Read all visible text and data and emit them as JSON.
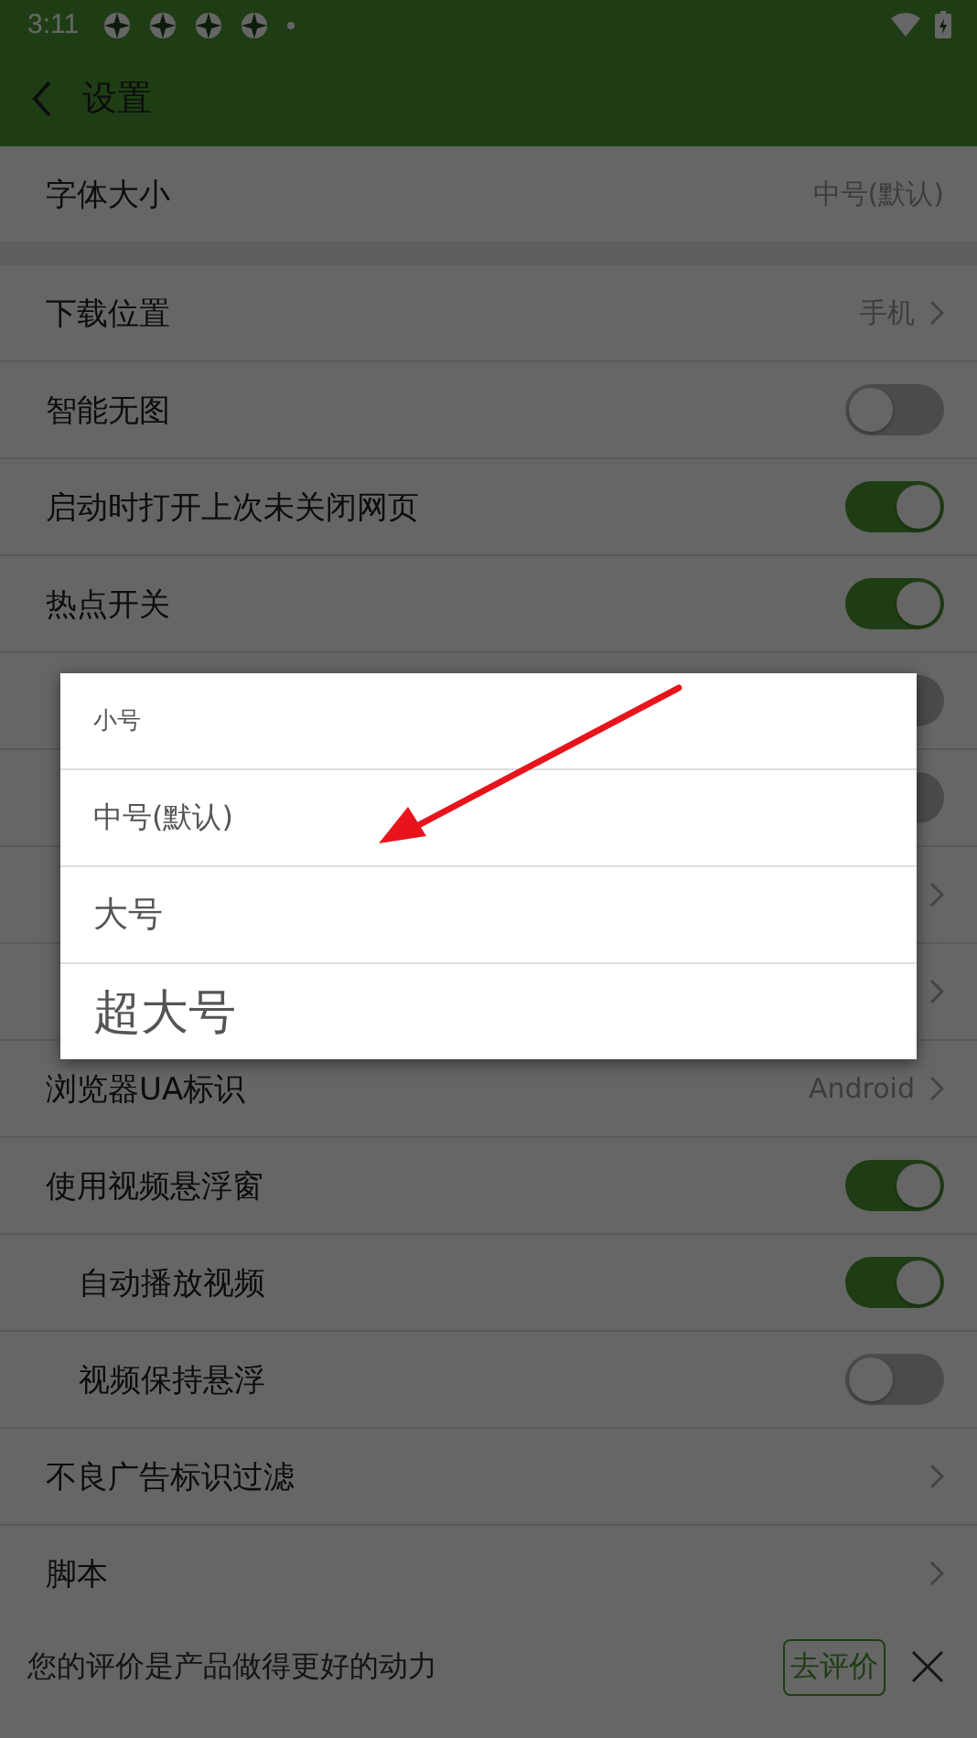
{
  "status_bar": {
    "time": "3:11"
  },
  "header": {
    "title": "设置"
  },
  "settings": [
    {
      "kind": "value",
      "label": "字体大小",
      "value": "中号(默认)",
      "section_end": true
    },
    {
      "kind": "link",
      "label": "下载位置",
      "value": "手机"
    },
    {
      "kind": "toggle",
      "label": "智能无图",
      "on": false
    },
    {
      "kind": "toggle",
      "label": "启动时打开上次未关闭网页",
      "on": true
    },
    {
      "kind": "toggle",
      "label": "热点开关",
      "on": true
    },
    {
      "kind": "toggle",
      "on": false
    },
    {
      "kind": "toggle",
      "on": false
    },
    {
      "kind": "link"
    },
    {
      "kind": "link"
    },
    {
      "kind": "link",
      "label": "浏览器UA标识",
      "value": "Android"
    },
    {
      "kind": "toggle",
      "label": "使用视频悬浮窗",
      "on": true
    },
    {
      "kind": "toggle",
      "label": "自动播放视频",
      "on": true,
      "indented": true
    },
    {
      "kind": "toggle",
      "label": "视频保持悬浮",
      "on": false,
      "indented": true
    },
    {
      "kind": "link",
      "label": "不良广告标识过滤"
    },
    {
      "kind": "link",
      "label": "脚本"
    }
  ],
  "rating_bar": {
    "text": "您的评价是产品做得更好的动力",
    "button": "去评价"
  },
  "font_size_dialog": {
    "options": [
      {
        "label": "小号",
        "kind": "small"
      },
      {
        "label": "中号(默认)",
        "kind": "medium"
      },
      {
        "label": "大号",
        "kind": "large"
      },
      {
        "label": "超大号",
        "kind": "xlarge"
      }
    ]
  }
}
